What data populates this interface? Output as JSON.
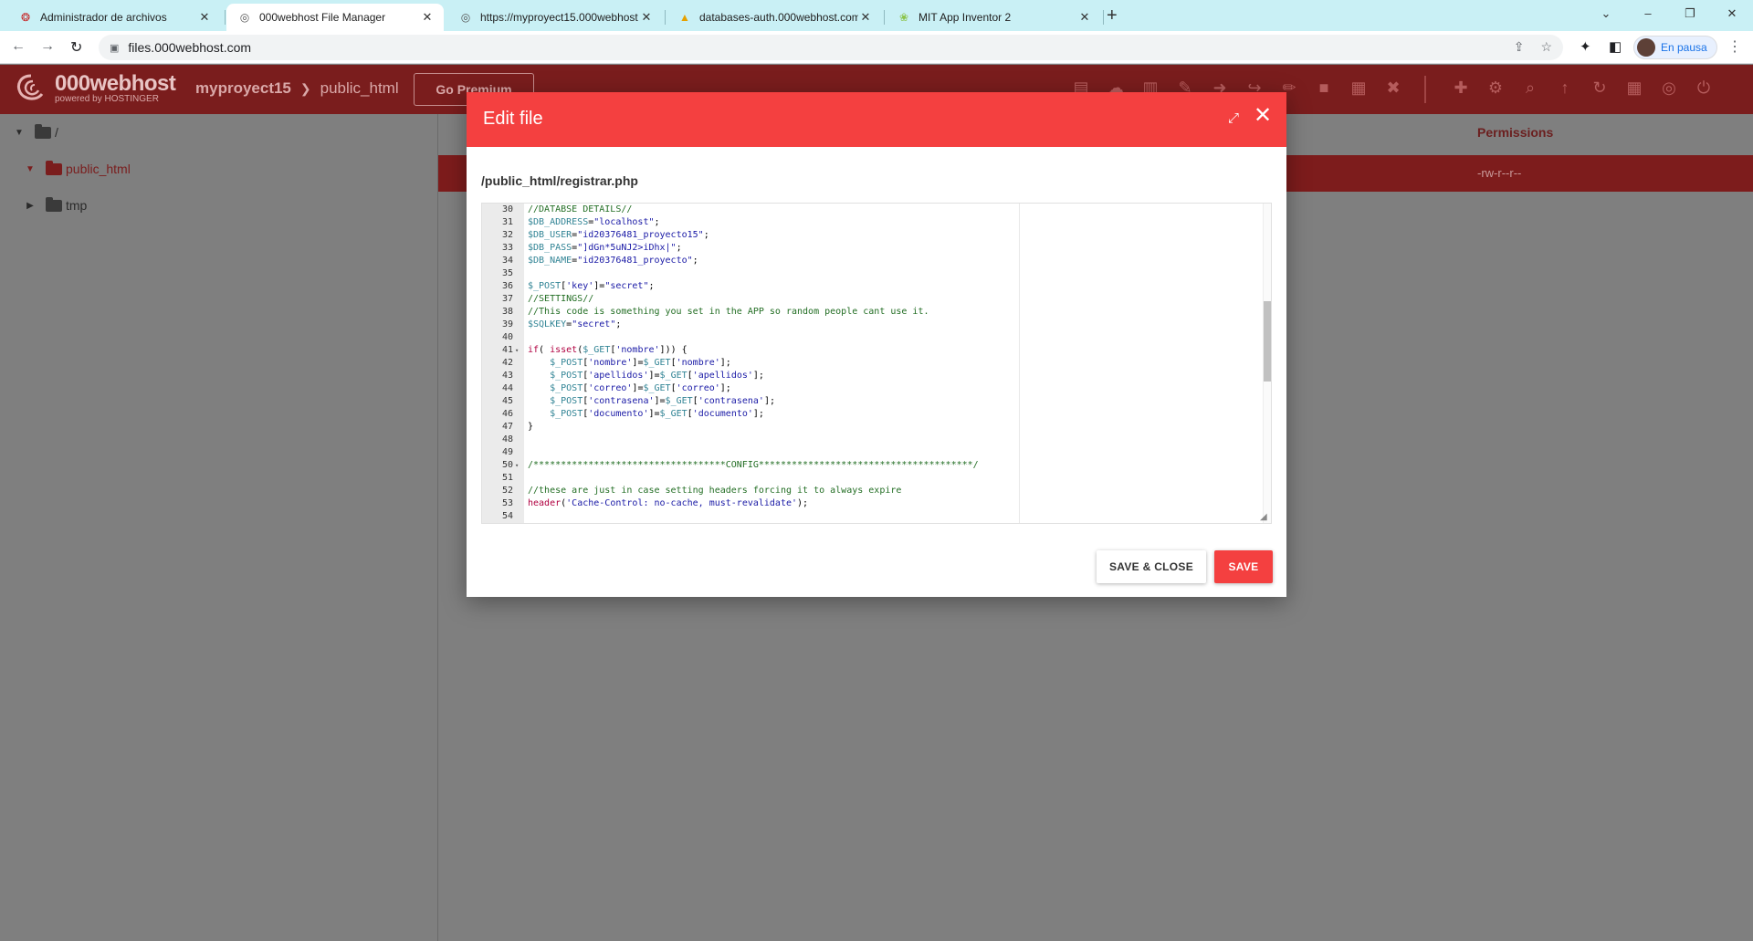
{
  "browser": {
    "tabs": [
      {
        "title": "Administrador de archivos",
        "icon": "000webhost-swirl-icon",
        "active": false
      },
      {
        "title": "000webhost File Manager",
        "icon": "globe-icon",
        "active": true
      },
      {
        "title": "https://myproyect15.000webhost",
        "icon": "globe-icon",
        "active": false
      },
      {
        "title": "databases-auth.000webhost.com",
        "icon": "phpmyadmin-icon",
        "active": false
      },
      {
        "title": "MIT App Inventor 2",
        "icon": "app-inventor-icon",
        "active": false
      }
    ],
    "new_tab_label": "+",
    "url": "files.000webhost.com",
    "profile_status": "En pausa"
  },
  "app": {
    "brand_name": "000webhost",
    "brand_sub": "powered by HOSTINGER",
    "breadcrumb": [
      "myproyect15",
      "public_html"
    ],
    "premium_label": "Go Premium",
    "toolbar_icons": [
      "new-folder-icon",
      "upload-icon",
      "new-file-icon",
      "edit-icon",
      "move-icon",
      "export-icon",
      "rename-icon",
      "lock-icon",
      "archive-icon",
      "delete-icon"
    ],
    "toolbar_icons_right": [
      "add-file-icon",
      "settings-icon",
      "search-icon",
      "cloud-upload-icon",
      "refresh-icon",
      "grid-icon",
      "globe-icon",
      "power-icon"
    ],
    "accent_color": "#f44040"
  },
  "tree": {
    "root_label": "/",
    "items": [
      {
        "label": "public_html",
        "expanded": true,
        "selected": true
      },
      {
        "label": "tmp",
        "expanded": false,
        "selected": false
      }
    ]
  },
  "file_list": {
    "permissions_header": "Permissions",
    "selected_row_permissions": "-rw-r--r--"
  },
  "modal": {
    "title": "Edit file",
    "file_path": "/public_html/registrar.php",
    "save_close_label": "SAVE & CLOSE",
    "save_label": "SAVE",
    "code_lines": [
      {
        "n": "30",
        "fold": false,
        "segs": [
          [
            "c-com",
            "//DATABSE DETAILS//"
          ]
        ]
      },
      {
        "n": "31",
        "fold": false,
        "segs": [
          [
            "c-var",
            "$DB_ADDRESS"
          ],
          [
            "c-pl",
            "="
          ],
          [
            "c-str",
            "\"localhost\""
          ],
          [
            "c-pl",
            ";"
          ]
        ]
      },
      {
        "n": "32",
        "fold": false,
        "segs": [
          [
            "c-var",
            "$DB_USER"
          ],
          [
            "c-pl",
            "="
          ],
          [
            "c-str",
            "\"id20376481_proyecto15\""
          ],
          [
            "c-pl",
            ";"
          ]
        ]
      },
      {
        "n": "33",
        "fold": false,
        "segs": [
          [
            "c-var",
            "$DB_PASS"
          ],
          [
            "c-pl",
            "="
          ],
          [
            "c-str",
            "\"]dGn*5uNJ2>iDhx|\""
          ],
          [
            "c-pl",
            ";"
          ]
        ]
      },
      {
        "n": "34",
        "fold": false,
        "segs": [
          [
            "c-var",
            "$DB_NAME"
          ],
          [
            "c-pl",
            "="
          ],
          [
            "c-str",
            "\"id20376481_proyecto\""
          ],
          [
            "c-pl",
            ";"
          ]
        ]
      },
      {
        "n": "35",
        "fold": false,
        "segs": []
      },
      {
        "n": "36",
        "fold": false,
        "segs": [
          [
            "c-var",
            "$_POST"
          ],
          [
            "c-pl",
            "["
          ],
          [
            "c-str",
            "'key'"
          ],
          [
            "c-pl",
            "]="
          ],
          [
            "c-str",
            "\"secret\""
          ],
          [
            "c-pl",
            ";"
          ]
        ]
      },
      {
        "n": "37",
        "fold": false,
        "segs": [
          [
            "c-com",
            "//SETTINGS//"
          ]
        ]
      },
      {
        "n": "38",
        "fold": false,
        "segs": [
          [
            "c-com",
            "//This code is something you set in the APP so random people cant use it."
          ]
        ]
      },
      {
        "n": "39",
        "fold": false,
        "segs": [
          [
            "c-var",
            "$SQLKEY"
          ],
          [
            "c-pl",
            "="
          ],
          [
            "c-str",
            "\"secret\""
          ],
          [
            "c-pl",
            ";"
          ]
        ]
      },
      {
        "n": "40",
        "fold": false,
        "segs": []
      },
      {
        "n": "41",
        "fold": true,
        "segs": [
          [
            "c-kw",
            "if"
          ],
          [
            "c-pl",
            "( "
          ],
          [
            "c-kw",
            "isset"
          ],
          [
            "c-pl",
            "("
          ],
          [
            "c-var",
            "$_GET"
          ],
          [
            "c-pl",
            "["
          ],
          [
            "c-str",
            "'nombre'"
          ],
          [
            "c-pl",
            "])) {"
          ]
        ]
      },
      {
        "n": "42",
        "fold": false,
        "segs": [
          [
            "c-pl",
            "    "
          ],
          [
            "c-var",
            "$_POST"
          ],
          [
            "c-pl",
            "["
          ],
          [
            "c-str",
            "'nombre'"
          ],
          [
            "c-pl",
            "]="
          ],
          [
            "c-var",
            "$_GET"
          ],
          [
            "c-pl",
            "["
          ],
          [
            "c-str",
            "'nombre'"
          ],
          [
            "c-pl",
            "];"
          ]
        ]
      },
      {
        "n": "43",
        "fold": false,
        "segs": [
          [
            "c-pl",
            "    "
          ],
          [
            "c-var",
            "$_POST"
          ],
          [
            "c-pl",
            "["
          ],
          [
            "c-str",
            "'apellidos'"
          ],
          [
            "c-pl",
            "]="
          ],
          [
            "c-var",
            "$_GET"
          ],
          [
            "c-pl",
            "["
          ],
          [
            "c-str",
            "'apellidos'"
          ],
          [
            "c-pl",
            "];"
          ]
        ]
      },
      {
        "n": "44",
        "fold": false,
        "segs": [
          [
            "c-pl",
            "    "
          ],
          [
            "c-var",
            "$_POST"
          ],
          [
            "c-pl",
            "["
          ],
          [
            "c-str",
            "'correo'"
          ],
          [
            "c-pl",
            "]="
          ],
          [
            "c-var",
            "$_GET"
          ],
          [
            "c-pl",
            "["
          ],
          [
            "c-str",
            "'correo'"
          ],
          [
            "c-pl",
            "];"
          ]
        ]
      },
      {
        "n": "45",
        "fold": false,
        "segs": [
          [
            "c-pl",
            "    "
          ],
          [
            "c-var",
            "$_POST"
          ],
          [
            "c-pl",
            "["
          ],
          [
            "c-str",
            "'contrasena'"
          ],
          [
            "c-pl",
            "]="
          ],
          [
            "c-var",
            "$_GET"
          ],
          [
            "c-pl",
            "["
          ],
          [
            "c-str",
            "'contrasena'"
          ],
          [
            "c-pl",
            "];"
          ]
        ]
      },
      {
        "n": "46",
        "fold": false,
        "segs": [
          [
            "c-pl",
            "    "
          ],
          [
            "c-var",
            "$_POST"
          ],
          [
            "c-pl",
            "["
          ],
          [
            "c-str",
            "'documento'"
          ],
          [
            "c-pl",
            "]="
          ],
          [
            "c-var",
            "$_GET"
          ],
          [
            "c-pl",
            "["
          ],
          [
            "c-str",
            "'documento'"
          ],
          [
            "c-pl",
            "];"
          ]
        ]
      },
      {
        "n": "47",
        "fold": false,
        "segs": [
          [
            "c-pl",
            "}"
          ]
        ]
      },
      {
        "n": "48",
        "fold": false,
        "segs": []
      },
      {
        "n": "49",
        "fold": false,
        "segs": []
      },
      {
        "n": "50",
        "fold": true,
        "segs": [
          [
            "c-com",
            "/***********************************CONFIG***************************************/"
          ]
        ]
      },
      {
        "n": "51",
        "fold": false,
        "segs": []
      },
      {
        "n": "52",
        "fold": false,
        "segs": [
          [
            "c-com",
            "//these are just in case setting headers forcing it to always expire"
          ]
        ]
      },
      {
        "n": "53",
        "fold": false,
        "segs": [
          [
            "c-kw",
            "header"
          ],
          [
            "c-pl",
            "("
          ],
          [
            "c-str",
            "'Cache-Control: no-cache, must-revalidate'"
          ],
          [
            "c-pl",
            ");"
          ]
        ]
      },
      {
        "n": "54",
        "fold": false,
        "segs": []
      }
    ]
  }
}
